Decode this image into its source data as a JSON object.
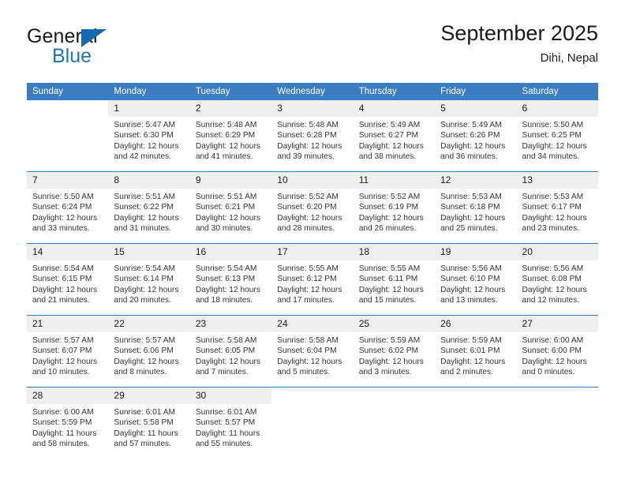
{
  "brand": {
    "name_top": "General",
    "name_bottom": "Blue",
    "flag_icon": "triangle-flag-icon",
    "accent_color": "#1569b2"
  },
  "header": {
    "title": "September 2025",
    "subtitle": "Dihi, Nepal"
  },
  "calendar": {
    "header_color": "#3a7dc0",
    "daynum_band_color": "#efefef",
    "weekdays": [
      "Sunday",
      "Monday",
      "Tuesday",
      "Wednesday",
      "Thursday",
      "Friday",
      "Saturday"
    ],
    "weeks": [
      [
        {
          "day": "",
          "sunrise": "",
          "sunset": "",
          "daylight_line1": "",
          "daylight_line2": ""
        },
        {
          "day": "1",
          "sunrise": "Sunrise: 5:47 AM",
          "sunset": "Sunset: 6:30 PM",
          "daylight_line1": "Daylight: 12 hours",
          "daylight_line2": "and 42 minutes."
        },
        {
          "day": "2",
          "sunrise": "Sunrise: 5:48 AM",
          "sunset": "Sunset: 6:29 PM",
          "daylight_line1": "Daylight: 12 hours",
          "daylight_line2": "and 41 minutes."
        },
        {
          "day": "3",
          "sunrise": "Sunrise: 5:48 AM",
          "sunset": "Sunset: 6:28 PM",
          "daylight_line1": "Daylight: 12 hours",
          "daylight_line2": "and 39 minutes."
        },
        {
          "day": "4",
          "sunrise": "Sunrise: 5:49 AM",
          "sunset": "Sunset: 6:27 PM",
          "daylight_line1": "Daylight: 12 hours",
          "daylight_line2": "and 38 minutes."
        },
        {
          "day": "5",
          "sunrise": "Sunrise: 5:49 AM",
          "sunset": "Sunset: 6:26 PM",
          "daylight_line1": "Daylight: 12 hours",
          "daylight_line2": "and 36 minutes."
        },
        {
          "day": "6",
          "sunrise": "Sunrise: 5:50 AM",
          "sunset": "Sunset: 6:25 PM",
          "daylight_line1": "Daylight: 12 hours",
          "daylight_line2": "and 34 minutes."
        }
      ],
      [
        {
          "day": "7",
          "sunrise": "Sunrise: 5:50 AM",
          "sunset": "Sunset: 6:24 PM",
          "daylight_line1": "Daylight: 12 hours",
          "daylight_line2": "and 33 minutes."
        },
        {
          "day": "8",
          "sunrise": "Sunrise: 5:51 AM",
          "sunset": "Sunset: 6:22 PM",
          "daylight_line1": "Daylight: 12 hours",
          "daylight_line2": "and 31 minutes."
        },
        {
          "day": "9",
          "sunrise": "Sunrise: 5:51 AM",
          "sunset": "Sunset: 6:21 PM",
          "daylight_line1": "Daylight: 12 hours",
          "daylight_line2": "and 30 minutes."
        },
        {
          "day": "10",
          "sunrise": "Sunrise: 5:52 AM",
          "sunset": "Sunset: 6:20 PM",
          "daylight_line1": "Daylight: 12 hours",
          "daylight_line2": "and 28 minutes."
        },
        {
          "day": "11",
          "sunrise": "Sunrise: 5:52 AM",
          "sunset": "Sunset: 6:19 PM",
          "daylight_line1": "Daylight: 12 hours",
          "daylight_line2": "and 26 minutes."
        },
        {
          "day": "12",
          "sunrise": "Sunrise: 5:53 AM",
          "sunset": "Sunset: 6:18 PM",
          "daylight_line1": "Daylight: 12 hours",
          "daylight_line2": "and 25 minutes."
        },
        {
          "day": "13",
          "sunrise": "Sunrise: 5:53 AM",
          "sunset": "Sunset: 6:17 PM",
          "daylight_line1": "Daylight: 12 hours",
          "daylight_line2": "and 23 minutes."
        }
      ],
      [
        {
          "day": "14",
          "sunrise": "Sunrise: 5:54 AM",
          "sunset": "Sunset: 6:15 PM",
          "daylight_line1": "Daylight: 12 hours",
          "daylight_line2": "and 21 minutes."
        },
        {
          "day": "15",
          "sunrise": "Sunrise: 5:54 AM",
          "sunset": "Sunset: 6:14 PM",
          "daylight_line1": "Daylight: 12 hours",
          "daylight_line2": "and 20 minutes."
        },
        {
          "day": "16",
          "sunrise": "Sunrise: 5:54 AM",
          "sunset": "Sunset: 6:13 PM",
          "daylight_line1": "Daylight: 12 hours",
          "daylight_line2": "and 18 minutes."
        },
        {
          "day": "17",
          "sunrise": "Sunrise: 5:55 AM",
          "sunset": "Sunset: 6:12 PM",
          "daylight_line1": "Daylight: 12 hours",
          "daylight_line2": "and 17 minutes."
        },
        {
          "day": "18",
          "sunrise": "Sunrise: 5:55 AM",
          "sunset": "Sunset: 6:11 PM",
          "daylight_line1": "Daylight: 12 hours",
          "daylight_line2": "and 15 minutes."
        },
        {
          "day": "19",
          "sunrise": "Sunrise: 5:56 AM",
          "sunset": "Sunset: 6:10 PM",
          "daylight_line1": "Daylight: 12 hours",
          "daylight_line2": "and 13 minutes."
        },
        {
          "day": "20",
          "sunrise": "Sunrise: 5:56 AM",
          "sunset": "Sunset: 6:08 PM",
          "daylight_line1": "Daylight: 12 hours",
          "daylight_line2": "and 12 minutes."
        }
      ],
      [
        {
          "day": "21",
          "sunrise": "Sunrise: 5:57 AM",
          "sunset": "Sunset: 6:07 PM",
          "daylight_line1": "Daylight: 12 hours",
          "daylight_line2": "and 10 minutes."
        },
        {
          "day": "22",
          "sunrise": "Sunrise: 5:57 AM",
          "sunset": "Sunset: 6:06 PM",
          "daylight_line1": "Daylight: 12 hours",
          "daylight_line2": "and 8 minutes."
        },
        {
          "day": "23",
          "sunrise": "Sunrise: 5:58 AM",
          "sunset": "Sunset: 6:05 PM",
          "daylight_line1": "Daylight: 12 hours",
          "daylight_line2": "and 7 minutes."
        },
        {
          "day": "24",
          "sunrise": "Sunrise: 5:58 AM",
          "sunset": "Sunset: 6:04 PM",
          "daylight_line1": "Daylight: 12 hours",
          "daylight_line2": "and 5 minutes."
        },
        {
          "day": "25",
          "sunrise": "Sunrise: 5:59 AM",
          "sunset": "Sunset: 6:02 PM",
          "daylight_line1": "Daylight: 12 hours",
          "daylight_line2": "and 3 minutes."
        },
        {
          "day": "26",
          "sunrise": "Sunrise: 5:59 AM",
          "sunset": "Sunset: 6:01 PM",
          "daylight_line1": "Daylight: 12 hours",
          "daylight_line2": "and 2 minutes."
        },
        {
          "day": "27",
          "sunrise": "Sunrise: 6:00 AM",
          "sunset": "Sunset: 6:00 PM",
          "daylight_line1": "Daylight: 12 hours",
          "daylight_line2": "and 0 minutes."
        }
      ],
      [
        {
          "day": "28",
          "sunrise": "Sunrise: 6:00 AM",
          "sunset": "Sunset: 5:59 PM",
          "daylight_line1": "Daylight: 11 hours",
          "daylight_line2": "and 58 minutes."
        },
        {
          "day": "29",
          "sunrise": "Sunrise: 6:01 AM",
          "sunset": "Sunset: 5:58 PM",
          "daylight_line1": "Daylight: 11 hours",
          "daylight_line2": "and 57 minutes."
        },
        {
          "day": "30",
          "sunrise": "Sunrise: 6:01 AM",
          "sunset": "Sunset: 5:57 PM",
          "daylight_line1": "Daylight: 11 hours",
          "daylight_line2": "and 55 minutes."
        },
        {
          "day": "",
          "sunrise": "",
          "sunset": "",
          "daylight_line1": "",
          "daylight_line2": ""
        },
        {
          "day": "",
          "sunrise": "",
          "sunset": "",
          "daylight_line1": "",
          "daylight_line2": ""
        },
        {
          "day": "",
          "sunrise": "",
          "sunset": "",
          "daylight_line1": "",
          "daylight_line2": ""
        },
        {
          "day": "",
          "sunrise": "",
          "sunset": "",
          "daylight_line1": "",
          "daylight_line2": ""
        }
      ]
    ]
  }
}
